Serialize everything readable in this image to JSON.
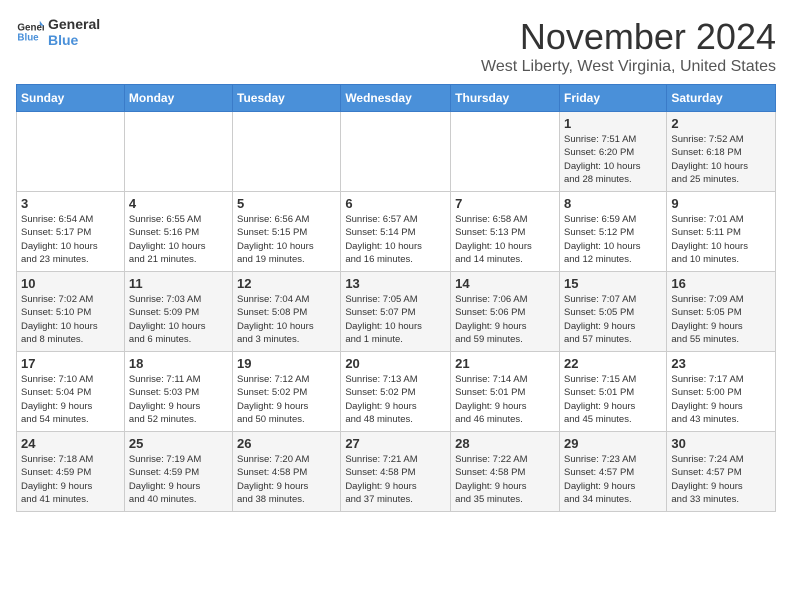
{
  "logo": {
    "line1": "General",
    "line2": "Blue"
  },
  "title": "November 2024",
  "location": "West Liberty, West Virginia, United States",
  "weekdays": [
    "Sunday",
    "Monday",
    "Tuesday",
    "Wednesday",
    "Thursday",
    "Friday",
    "Saturday"
  ],
  "weeks": [
    [
      {
        "day": "",
        "info": ""
      },
      {
        "day": "",
        "info": ""
      },
      {
        "day": "",
        "info": ""
      },
      {
        "day": "",
        "info": ""
      },
      {
        "day": "",
        "info": ""
      },
      {
        "day": "1",
        "info": "Sunrise: 7:51 AM\nSunset: 6:20 PM\nDaylight: 10 hours\nand 28 minutes."
      },
      {
        "day": "2",
        "info": "Sunrise: 7:52 AM\nSunset: 6:18 PM\nDaylight: 10 hours\nand 25 minutes."
      }
    ],
    [
      {
        "day": "3",
        "info": "Sunrise: 6:54 AM\nSunset: 5:17 PM\nDaylight: 10 hours\nand 23 minutes."
      },
      {
        "day": "4",
        "info": "Sunrise: 6:55 AM\nSunset: 5:16 PM\nDaylight: 10 hours\nand 21 minutes."
      },
      {
        "day": "5",
        "info": "Sunrise: 6:56 AM\nSunset: 5:15 PM\nDaylight: 10 hours\nand 19 minutes."
      },
      {
        "day": "6",
        "info": "Sunrise: 6:57 AM\nSunset: 5:14 PM\nDaylight: 10 hours\nand 16 minutes."
      },
      {
        "day": "7",
        "info": "Sunrise: 6:58 AM\nSunset: 5:13 PM\nDaylight: 10 hours\nand 14 minutes."
      },
      {
        "day": "8",
        "info": "Sunrise: 6:59 AM\nSunset: 5:12 PM\nDaylight: 10 hours\nand 12 minutes."
      },
      {
        "day": "9",
        "info": "Sunrise: 7:01 AM\nSunset: 5:11 PM\nDaylight: 10 hours\nand 10 minutes."
      }
    ],
    [
      {
        "day": "10",
        "info": "Sunrise: 7:02 AM\nSunset: 5:10 PM\nDaylight: 10 hours\nand 8 minutes."
      },
      {
        "day": "11",
        "info": "Sunrise: 7:03 AM\nSunset: 5:09 PM\nDaylight: 10 hours\nand 6 minutes."
      },
      {
        "day": "12",
        "info": "Sunrise: 7:04 AM\nSunset: 5:08 PM\nDaylight: 10 hours\nand 3 minutes."
      },
      {
        "day": "13",
        "info": "Sunrise: 7:05 AM\nSunset: 5:07 PM\nDaylight: 10 hours\nand 1 minute."
      },
      {
        "day": "14",
        "info": "Sunrise: 7:06 AM\nSunset: 5:06 PM\nDaylight: 9 hours\nand 59 minutes."
      },
      {
        "day": "15",
        "info": "Sunrise: 7:07 AM\nSunset: 5:05 PM\nDaylight: 9 hours\nand 57 minutes."
      },
      {
        "day": "16",
        "info": "Sunrise: 7:09 AM\nSunset: 5:05 PM\nDaylight: 9 hours\nand 55 minutes."
      }
    ],
    [
      {
        "day": "17",
        "info": "Sunrise: 7:10 AM\nSunset: 5:04 PM\nDaylight: 9 hours\nand 54 minutes."
      },
      {
        "day": "18",
        "info": "Sunrise: 7:11 AM\nSunset: 5:03 PM\nDaylight: 9 hours\nand 52 minutes."
      },
      {
        "day": "19",
        "info": "Sunrise: 7:12 AM\nSunset: 5:02 PM\nDaylight: 9 hours\nand 50 minutes."
      },
      {
        "day": "20",
        "info": "Sunrise: 7:13 AM\nSunset: 5:02 PM\nDaylight: 9 hours\nand 48 minutes."
      },
      {
        "day": "21",
        "info": "Sunrise: 7:14 AM\nSunset: 5:01 PM\nDaylight: 9 hours\nand 46 minutes."
      },
      {
        "day": "22",
        "info": "Sunrise: 7:15 AM\nSunset: 5:01 PM\nDaylight: 9 hours\nand 45 minutes."
      },
      {
        "day": "23",
        "info": "Sunrise: 7:17 AM\nSunset: 5:00 PM\nDaylight: 9 hours\nand 43 minutes."
      }
    ],
    [
      {
        "day": "24",
        "info": "Sunrise: 7:18 AM\nSunset: 4:59 PM\nDaylight: 9 hours\nand 41 minutes."
      },
      {
        "day": "25",
        "info": "Sunrise: 7:19 AM\nSunset: 4:59 PM\nDaylight: 9 hours\nand 40 minutes."
      },
      {
        "day": "26",
        "info": "Sunrise: 7:20 AM\nSunset: 4:58 PM\nDaylight: 9 hours\nand 38 minutes."
      },
      {
        "day": "27",
        "info": "Sunrise: 7:21 AM\nSunset: 4:58 PM\nDaylight: 9 hours\nand 37 minutes."
      },
      {
        "day": "28",
        "info": "Sunrise: 7:22 AM\nSunset: 4:58 PM\nDaylight: 9 hours\nand 35 minutes."
      },
      {
        "day": "29",
        "info": "Sunrise: 7:23 AM\nSunset: 4:57 PM\nDaylight: 9 hours\nand 34 minutes."
      },
      {
        "day": "30",
        "info": "Sunrise: 7:24 AM\nSunset: 4:57 PM\nDaylight: 9 hours\nand 33 minutes."
      }
    ]
  ]
}
